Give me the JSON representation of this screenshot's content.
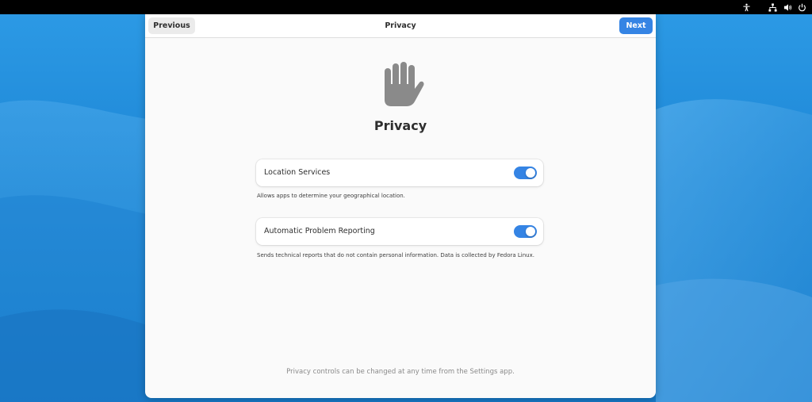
{
  "window": {
    "title": "Privacy",
    "previous_label": "Previous",
    "next_label": "Next"
  },
  "page": {
    "heading": "Privacy",
    "icon": "hand-icon"
  },
  "settings": [
    {
      "label": "Location Services",
      "enabled": true,
      "description": "Allows apps to determine your geographical location."
    },
    {
      "label": "Automatic Problem Reporting",
      "enabled": true,
      "description": "Sends technical reports that do not contain personal information. Data is collected by Fedora Linux."
    }
  ],
  "footer": "Privacy controls can be changed at any time from the Settings app.",
  "system_tray": [
    "accessibility-icon",
    "network-icon",
    "volume-icon",
    "power-icon"
  ],
  "colors": {
    "accent": "#3584e4",
    "desktop": "#1d86d5"
  }
}
